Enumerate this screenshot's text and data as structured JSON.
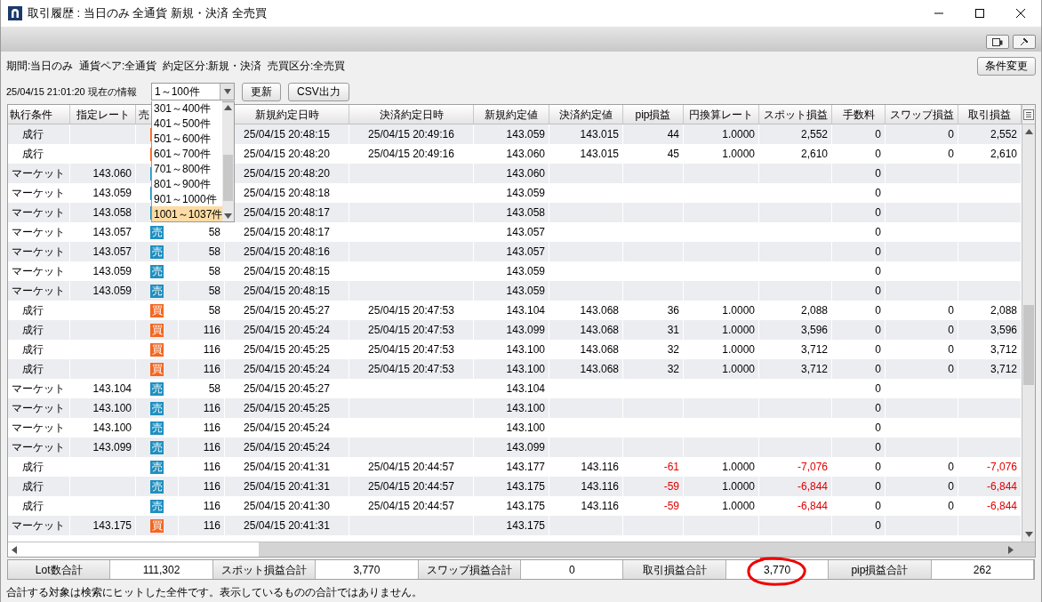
{
  "window": {
    "title": "取引履歴 : 当日のみ 全通貨 新規・決済 全売買"
  },
  "filters": "期間:当日のみ  通貨ペア:全通貨  約定区分:新規・決済  売買区分:全売買",
  "change_button": "条件変更",
  "timestamp": "25/04/15 21:01:20 現在の情報",
  "range_select": {
    "value": "1～100件",
    "open": true,
    "options": [
      {
        "label": "301～400件",
        "selected": false
      },
      {
        "label": "401～500件",
        "selected": false
      },
      {
        "label": "501～600件",
        "selected": false
      },
      {
        "label": "601～700件",
        "selected": false
      },
      {
        "label": "701～800件",
        "selected": false
      },
      {
        "label": "801～900件",
        "selected": false
      },
      {
        "label": "901～1000件",
        "selected": false
      },
      {
        "label": "1001～1037件",
        "selected": true
      }
    ]
  },
  "buttons": [
    "更新",
    "CSV出力"
  ],
  "table": {
    "columns": [
      "執行条件",
      "指定レート",
      "売",
      "新規約定日時",
      "決済約定日時",
      "新規約定値",
      "決済約定値",
      "pip損益",
      "円換算レート",
      "スポット損益",
      "手数料",
      "スワップ損益",
      "取引損益"
    ],
    "rows": [
      {
        "kind": "close",
        "loss": false,
        "side": {
          "kind": "buy"
        },
        "exec": "成行",
        "open_time": "25/04/15 20:48:15",
        "close_time": "25/04/15 20:49:16",
        "open_price": "143.059",
        "close_price": "143.015",
        "pips": "44",
        "jpy_rate": "1.0000",
        "spot": "2,552",
        "fee": "0",
        "swap": "0",
        "pl": "2,552"
      },
      {
        "kind": "close",
        "loss": false,
        "side": {
          "kind": "buy"
        },
        "exec": "成行",
        "open_time": "25/04/15 20:48:20",
        "close_time": "25/04/15 20:49:16",
        "open_price": "143.060",
        "close_price": "143.015",
        "pips": "45",
        "jpy_rate": "1.0000",
        "spot": "2,610",
        "fee": "0",
        "swap": "0",
        "pl": "2,610"
      },
      {
        "kind": "open",
        "side": {
          "kind": "sell"
        },
        "exec": "マーケット",
        "rate": "143.060",
        "open_time": "25/04/15 20:48:20",
        "open_price": "143.060",
        "fee": "0"
      },
      {
        "kind": "open",
        "side": {
          "kind": "sell"
        },
        "exec": "マーケット",
        "rate": "143.059",
        "open_time": "25/04/15 20:48:18",
        "open_price": "143.059",
        "fee": "0"
      },
      {
        "kind": "open",
        "side": {
          "kind": "sell"
        },
        "exec": "マーケット",
        "rate": "143.058",
        "open_time": "25/04/15 20:48:17",
        "open_price": "143.058",
        "fee": "0"
      },
      {
        "kind": "open",
        "side": {
          "kind": "sell",
          "label": "売"
        },
        "exec": "マーケット",
        "rate": "143.057",
        "lot": "58",
        "open_time": "25/04/15 20:48:17",
        "open_price": "143.057",
        "fee": "0"
      },
      {
        "kind": "open",
        "side": {
          "kind": "sell",
          "label": "売"
        },
        "exec": "マーケット",
        "rate": "143.057",
        "lot": "58",
        "open_time": "25/04/15 20:48:16",
        "open_price": "143.057",
        "fee": "0"
      },
      {
        "kind": "open",
        "side": {
          "kind": "sell",
          "label": "売"
        },
        "exec": "マーケット",
        "rate": "143.059",
        "lot": "58",
        "open_time": "25/04/15 20:48:15",
        "open_price": "143.059",
        "fee": "0"
      },
      {
        "kind": "open",
        "side": {
          "kind": "sell",
          "label": "売"
        },
        "exec": "マーケット",
        "rate": "143.059",
        "lot": "58",
        "open_time": "25/04/15 20:48:15",
        "open_price": "143.059",
        "fee": "0"
      },
      {
        "kind": "close",
        "loss": false,
        "side": {
          "kind": "buy",
          "label": "買"
        },
        "exec": "成行",
        "lot": "58",
        "open_time": "25/04/15 20:45:27",
        "close_time": "25/04/15 20:47:53",
        "open_price": "143.104",
        "close_price": "143.068",
        "pips": "36",
        "jpy_rate": "1.0000",
        "spot": "2,088",
        "fee": "0",
        "swap": "0",
        "pl": "2,088"
      },
      {
        "kind": "close",
        "loss": false,
        "side": {
          "kind": "buy",
          "label": "買"
        },
        "exec": "成行",
        "lot": "116",
        "open_time": "25/04/15 20:45:24",
        "close_time": "25/04/15 20:47:53",
        "open_price": "143.099",
        "close_price": "143.068",
        "pips": "31",
        "jpy_rate": "1.0000",
        "spot": "3,596",
        "fee": "0",
        "swap": "0",
        "pl": "3,596"
      },
      {
        "kind": "close",
        "loss": false,
        "side": {
          "kind": "buy",
          "label": "買"
        },
        "exec": "成行",
        "lot": "116",
        "open_time": "25/04/15 20:45:25",
        "close_time": "25/04/15 20:47:53",
        "open_price": "143.100",
        "close_price": "143.068",
        "pips": "32",
        "jpy_rate": "1.0000",
        "spot": "3,712",
        "fee": "0",
        "swap": "0",
        "pl": "3,712"
      },
      {
        "kind": "close",
        "loss": false,
        "side": {
          "kind": "buy",
          "label": "買"
        },
        "exec": "成行",
        "lot": "116",
        "open_time": "25/04/15 20:45:24",
        "close_time": "25/04/15 20:47:53",
        "open_price": "143.100",
        "close_price": "143.068",
        "pips": "32",
        "jpy_rate": "1.0000",
        "spot": "3,712",
        "fee": "0",
        "swap": "0",
        "pl": "3,712"
      },
      {
        "kind": "open",
        "side": {
          "kind": "sell",
          "label": "売"
        },
        "exec": "マーケット",
        "rate": "143.104",
        "lot": "58",
        "open_time": "25/04/15 20:45:27",
        "open_price": "143.104",
        "fee": "0"
      },
      {
        "kind": "open",
        "side": {
          "kind": "sell",
          "label": "売"
        },
        "exec": "マーケット",
        "rate": "143.100",
        "lot": "116",
        "open_time": "25/04/15 20:45:25",
        "open_price": "143.100",
        "fee": "0"
      },
      {
        "kind": "open",
        "side": {
          "kind": "sell",
          "label": "売"
        },
        "exec": "マーケット",
        "rate": "143.100",
        "lot": "116",
        "open_time": "25/04/15 20:45:24",
        "open_price": "143.100",
        "fee": "0"
      },
      {
        "kind": "open",
        "side": {
          "kind": "sell",
          "label": "売"
        },
        "exec": "マーケット",
        "rate": "143.099",
        "lot": "116",
        "open_time": "25/04/15 20:45:24",
        "open_price": "143.099",
        "fee": "0"
      },
      {
        "kind": "close",
        "loss": true,
        "side": {
          "kind": "sell",
          "label": "売"
        },
        "exec": "成行",
        "lot": "116",
        "open_time": "25/04/15 20:41:31",
        "close_time": "25/04/15 20:44:57",
        "open_price": "143.177",
        "close_price": "143.116",
        "pips": "-61",
        "jpy_rate": "1.0000",
        "spot": "-7,076",
        "fee": "0",
        "swap": "0",
        "pl": "-7,076"
      },
      {
        "kind": "close",
        "loss": true,
        "side": {
          "kind": "sell",
          "label": "売"
        },
        "exec": "成行",
        "lot": "116",
        "open_time": "25/04/15 20:41:31",
        "close_time": "25/04/15 20:44:57",
        "open_price": "143.175",
        "close_price": "143.116",
        "pips": "-59",
        "jpy_rate": "1.0000",
        "spot": "-6,844",
        "fee": "0",
        "swap": "0",
        "pl": "-6,844"
      },
      {
        "kind": "close",
        "loss": true,
        "side": {
          "kind": "sell",
          "label": "売"
        },
        "exec": "成行",
        "lot": "116",
        "open_time": "25/04/15 20:41:30",
        "close_time": "25/04/15 20:44:57",
        "open_price": "143.175",
        "close_price": "143.116",
        "pips": "-59",
        "jpy_rate": "1.0000",
        "spot": "-6,844",
        "fee": "0",
        "swap": "0",
        "pl": "-6,844"
      },
      {
        "kind": "open",
        "side": {
          "kind": "buy",
          "label": "買"
        },
        "exec": "マーケット",
        "rate": "143.175",
        "lot": "116",
        "open_time": "25/04/15 20:41:31",
        "open_price": "143.175",
        "fee": "0"
      }
    ]
  },
  "totals": [
    {
      "label": "Lot数合計",
      "value": "111,302",
      "circled": false
    },
    {
      "label": "スポット損益合計",
      "value": "3,770",
      "circled": false
    },
    {
      "label": "スワップ損益合計",
      "value": "0",
      "circled": false
    },
    {
      "label": "取引損益合計",
      "value": "3,770",
      "circled": true
    },
    {
      "label": "pip損益合計",
      "value": "262",
      "circled": false
    }
  ],
  "note": "合計する対象は検索にヒットした全件です。表示しているものの合計ではありません。"
}
